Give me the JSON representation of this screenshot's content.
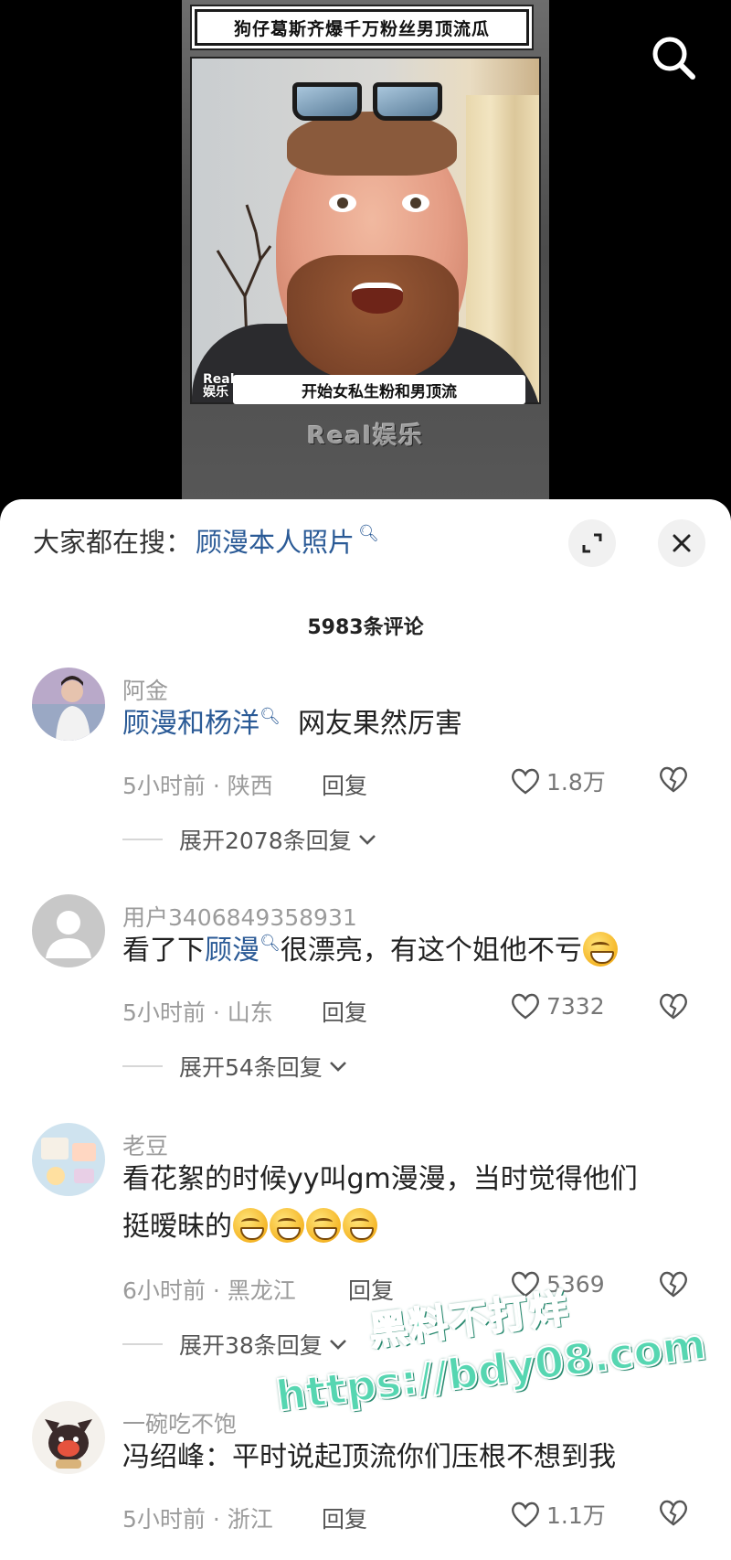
{
  "video": {
    "title": "狗仔葛斯齐爆千万粉丝男顶流瓜",
    "caption": "开始女私生粉和男顶流",
    "mini_logo_line1": "Real",
    "mini_logo_line2": "娱乐",
    "brand": "Real娱乐",
    "search_icon": "search-icon"
  },
  "sheet": {
    "hot_search_prefix": "大家都在搜：",
    "hot_search_keyword": "顾漫本人照片",
    "comment_count": "5983条评论"
  },
  "comments": [
    {
      "user": "阿金",
      "link": "顾漫和杨洋",
      "text_after": "网友果然厉害",
      "meta": "5小时前 · 陕西",
      "reply": "回复",
      "likes": "1.8万",
      "more": "展开2078条回复"
    },
    {
      "user": "用户3406849358931",
      "text_before": "看了下",
      "link": "顾漫",
      "text_after": "很漂亮，有这个姐他不亏",
      "meta": "5小时前 · 山东",
      "reply": "回复",
      "likes": "7332",
      "more": "展开54条回复"
    },
    {
      "user": "老豆",
      "text_line1": "看花絮的时候yy叫gm漫漫，当时觉得他们",
      "text_line2": "挺暧昧的",
      "meta": "6小时前 · 黑龙江",
      "reply": "回复",
      "likes": "5369",
      "more": "展开38条回复"
    },
    {
      "user": "一碗吃不饱",
      "text": "冯绍峰：平时说起顶流你们压根不想到我",
      "meta": "5小时前 · 浙江",
      "reply": "回复",
      "likes": "1.1万"
    }
  ],
  "watermark": {
    "line1": "黑料不打烊",
    "line2": "https://bdy08.com"
  }
}
